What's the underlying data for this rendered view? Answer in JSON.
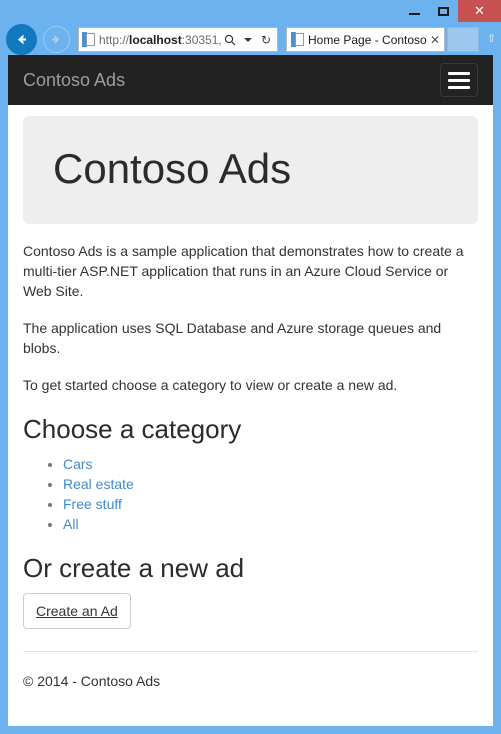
{
  "browser": {
    "window_controls": {
      "minimize_label": "–",
      "maximize_label": "□",
      "close_label": "✕"
    },
    "back_label": "←",
    "forward_label": "→",
    "address": {
      "scheme_prefix": "http://",
      "host": "localhost",
      "port_and_rest": ":30351,",
      "full_url": "http://localhost:30351,",
      "search_icon": "search-icon",
      "caret_icon": "chevron-down-icon",
      "refresh_icon": "refresh-icon",
      "refresh_label": "↻",
      "search_label": "⚲"
    },
    "tab": {
      "title": "Home Page - Contoso...",
      "close_label": "✕"
    },
    "new_tab_label": ""
  },
  "page": {
    "navbar": {
      "brand": "Contoso Ads",
      "toggle_name": "hamburger-menu"
    },
    "jumbotron": {
      "heading": "Contoso Ads"
    },
    "paragraphs": [
      "Contoso Ads is a sample application that demonstrates how to create a multi-tier ASP.NET application that runs in an Azure Cloud Service or Web Site.",
      "The application uses SQL Database and Azure storage queues and blobs.",
      "To get started choose a category to view or create a new ad."
    ],
    "category_section": {
      "title": "Choose a category",
      "links": [
        {
          "label": "Cars"
        },
        {
          "label": "Real estate"
        },
        {
          "label": "Free stuff"
        },
        {
          "label": "All"
        }
      ]
    },
    "create_section": {
      "title": "Or create a new ad",
      "button_label": "Create an Ad"
    },
    "footer": {
      "text": "© 2014 - Contoso Ads"
    }
  },
  "colors": {
    "navbar_bg": "#222222",
    "brand_text": "#9d9d9d",
    "jumbotron_bg": "#eeeeee",
    "link_blue": "#428bca",
    "chrome_blue": "#6cb2ef",
    "close_red": "#c75050"
  }
}
